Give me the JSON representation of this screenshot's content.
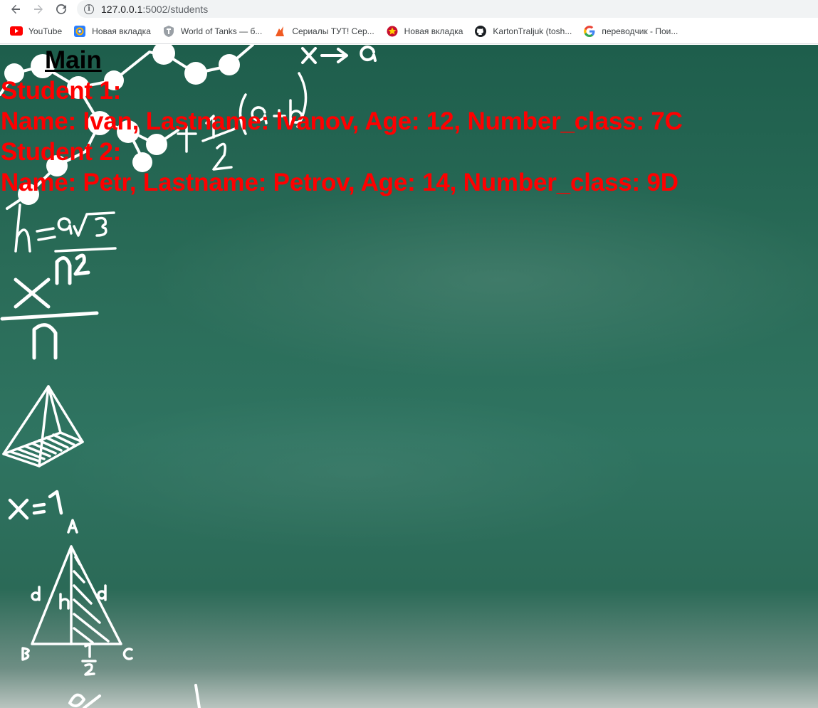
{
  "browser": {
    "url_host": "127.0.0.1",
    "url_rest": ":5002/students",
    "bookmarks": [
      {
        "label": "YouTube",
        "icon": "youtube-icon"
      },
      {
        "label": "Новая вкладка",
        "icon": "mail-at-icon"
      },
      {
        "label": "World of Tanks — б...",
        "icon": "wot-shield-icon"
      },
      {
        "label": "Сериалы ТУТ! Сер...",
        "icon": "fox-icon"
      },
      {
        "label": "Новая вкладка",
        "icon": "star-badge-icon"
      },
      {
        "label": "KartonTraljuk (tosh...",
        "icon": "github-icon"
      },
      {
        "label": "переводчик - Пои...",
        "icon": "google-icon"
      }
    ]
  },
  "page": {
    "main_link": "Main",
    "lines": [
      "Student 1:",
      "Name: Ivan, Lastname: Ivanov, Age: 12, Number_class: 7C",
      "Student 2:",
      "Name: Petr, Lastname: Petrov, Age: 14, Number_class: 9D"
    ],
    "chalk_text": [
      "x→a",
      "(a+b)",
      "1",
      "2",
      "h=a√3",
      "x",
      "n",
      "2",
      "n",
      "x=1",
      "A",
      "b",
      "h",
      "b",
      "B",
      "C",
      "1",
      "2"
    ]
  },
  "colors": {
    "board": "#2a6c58",
    "student_text": "#ff0000",
    "link": "#000000"
  }
}
